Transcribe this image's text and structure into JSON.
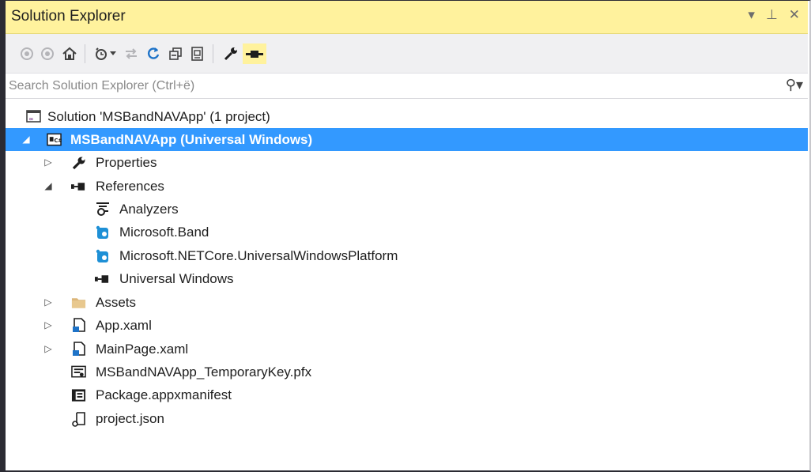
{
  "window": {
    "title": "Solution Explorer",
    "controls": {
      "dropdown": "▾",
      "pin": "⊥",
      "close": "✕"
    }
  },
  "colors": {
    "title_bg": "#fff29d",
    "selection": "#3399ff",
    "toolbar_bg": "#f0f0f2"
  },
  "toolbar": {
    "icons": [
      "back-icon",
      "forward-icon",
      "home-icon",
      "pending-changes-icon",
      "sync-icon",
      "refresh-icon",
      "collapse-all-icon",
      "show-all-files-icon",
      "properties-icon",
      "preview-icon"
    ]
  },
  "search": {
    "placeholder": "Search Solution Explorer (Ctrl+ë)"
  },
  "tree": {
    "solution": "Solution 'MSBandNAVApp' (1 project)",
    "project": "MSBandNAVApp (Universal Windows)",
    "properties": "Properties",
    "references": "References",
    "analyzers": "Analyzers",
    "microsoft_band": "Microsoft.Band",
    "netcore": "Microsoft.NETCore.UniversalWindowsPlatform",
    "universal_windows": "Universal Windows",
    "assets": "Assets",
    "app_xaml": "App.xaml",
    "mainpage_xaml": "MainPage.xaml",
    "temporary_key": "MSBandNAVApp_TemporaryKey.pfx",
    "manifest": "Package.appxmanifest",
    "project_json": "project.json"
  }
}
